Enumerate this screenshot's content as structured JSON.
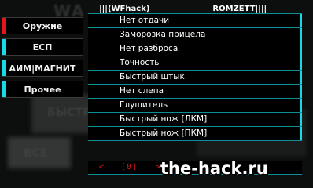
{
  "title": {
    "left": "|||(WFhack)",
    "right": "ROMZETT||||"
  },
  "tabs": [
    {
      "label": "Оружие",
      "active": true
    },
    {
      "label": "ЕСП",
      "active": false
    },
    {
      "label": "АИМ|МАГНИТ",
      "active": false
    },
    {
      "label": "Прочее",
      "active": false
    }
  ],
  "menu": {
    "items": [
      "Нет отдачи",
      "Заморозка прицела",
      "Нет разброса",
      "Точность",
      "Быстрый штык",
      "Нет слепа",
      "Глушитель",
      "Быстрый нож [ЛКМ]",
      "Быстрый нож [ПКМ]"
    ]
  },
  "pager": {
    "prev": "<",
    "page": "[0]",
    "next": ">"
  },
  "watermark": "the-hack.ru",
  "colors": {
    "accent": "#19d9e6",
    "active": "#e5151b",
    "divider": "#0e8f98"
  }
}
